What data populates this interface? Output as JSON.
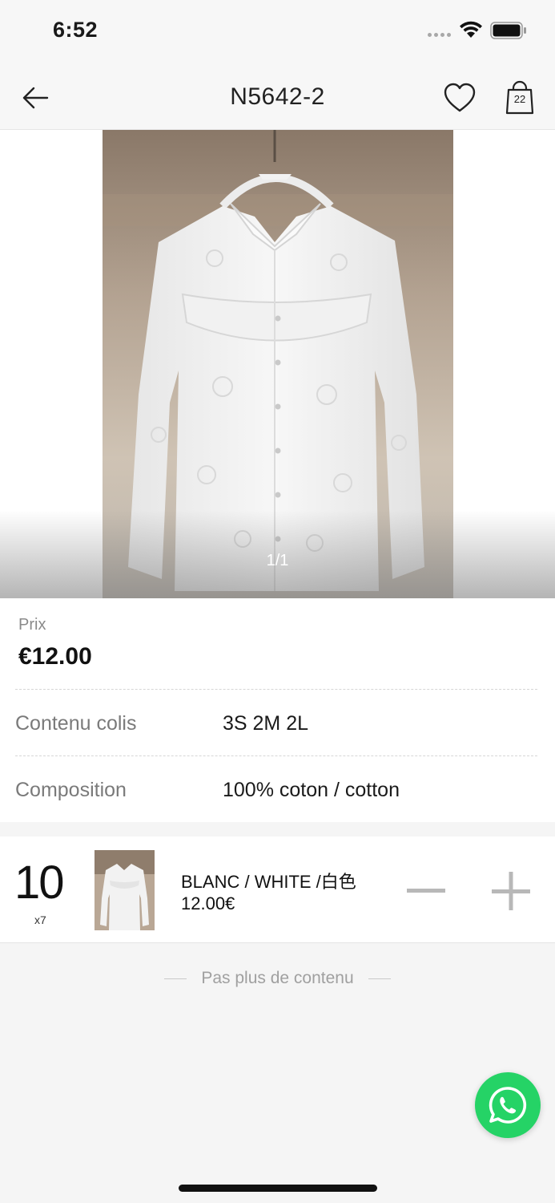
{
  "status_bar": {
    "time": "6:52"
  },
  "header": {
    "title": "N5642-2",
    "cart_count": "22"
  },
  "gallery": {
    "page_indicator": "1/1"
  },
  "product": {
    "price_label": "Prix",
    "price": "€12.00",
    "details": [
      {
        "label": "Contenu colis",
        "value": "3S 2M 2L"
      },
      {
        "label": "Composition",
        "value": "100% coton / cotton"
      }
    ]
  },
  "variant": {
    "quantity": "10",
    "multiplier": "x7",
    "name": "BLANC / WHITE /白色",
    "price": "12.00€"
  },
  "footer": {
    "end_text": "Pas plus de contenu"
  },
  "icons": {
    "back": "arrow-left-icon",
    "favorite": "heart-icon",
    "cart": "shopping-bag-icon",
    "decrease": "minus-icon",
    "increase": "plus-icon",
    "chat": "whatsapp-icon"
  },
  "colors": {
    "whatsapp": "#25d366",
    "background": "#f5f5f5"
  }
}
